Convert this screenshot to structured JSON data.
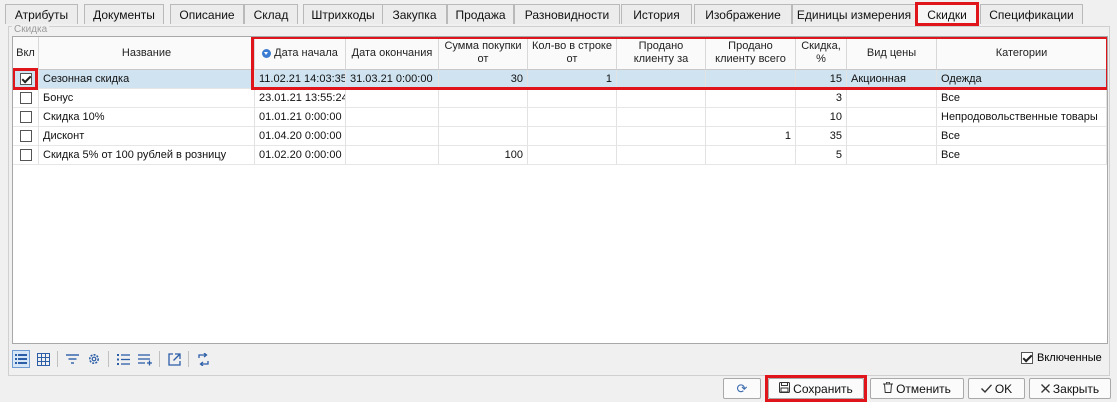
{
  "tabs": [
    {
      "label": "Атрибуты"
    },
    {
      "label": "Документы"
    },
    {
      "label": "Описание"
    },
    {
      "label": "Склад"
    },
    {
      "label": "Штрихкоды"
    },
    {
      "label": "Закупка"
    },
    {
      "label": "Продажа"
    },
    {
      "label": "Разновидности"
    },
    {
      "label": "История"
    },
    {
      "label": "Изображение"
    },
    {
      "label": "Единицы измерения"
    },
    {
      "label": "Скидки"
    },
    {
      "label": "Спецификации"
    }
  ],
  "group_title": "Скидка",
  "grid": {
    "columns": [
      {
        "label": "Вкл"
      },
      {
        "label": "Название"
      },
      {
        "label": "Дата начала"
      },
      {
        "label": "Дата окончания"
      },
      {
        "label": "Сумма покупки от"
      },
      {
        "label": "Кол-во в строке от"
      },
      {
        "label": "Продано клиенту за"
      },
      {
        "label": "Продано клиенту всего"
      },
      {
        "label": "Скидка, %"
      },
      {
        "label": "Вид цены"
      },
      {
        "label": "Категории"
      }
    ],
    "rows": [
      {
        "enabled": true,
        "name": "Сезонная скидка",
        "start": "11.02.21 14:03:35",
        "end": "31.03.21 0:00:00",
        "sum_from": "30",
        "qty_from": "1",
        "sold_for": "",
        "sold_total": "",
        "discount": "15",
        "price_type": "Акционная",
        "category": "Одежда"
      },
      {
        "enabled": false,
        "name": "Бонус",
        "start": "23.01.21 13:55:24",
        "end": "",
        "sum_from": "",
        "qty_from": "",
        "sold_for": "",
        "sold_total": "",
        "discount": "3",
        "price_type": "",
        "category": "Все"
      },
      {
        "enabled": false,
        "name": "Скидка 10%",
        "start": "01.01.21 0:00:00",
        "end": "",
        "sum_from": "",
        "qty_from": "",
        "sold_for": "",
        "sold_total": "",
        "discount": "10",
        "price_type": "",
        "category": "Непродовольственные товары"
      },
      {
        "enabled": false,
        "name": "Дисконт",
        "start": "01.04.20 0:00:00",
        "end": "",
        "sum_from": "",
        "qty_from": "",
        "sold_for": "",
        "sold_total": "1",
        "discount": "35",
        "price_type": "",
        "category": "Все"
      },
      {
        "enabled": false,
        "name": "Скидка 5% от 100 рублей в розницу",
        "start": "01.02.20 0:00:00",
        "end": "",
        "sum_from": "100",
        "qty_from": "",
        "sold_for": "",
        "sold_total": "",
        "discount": "5",
        "price_type": "",
        "category": "Все"
      }
    ]
  },
  "toolbar": {
    "icons": [
      "list-view-icon",
      "table-view-icon",
      "filter-icon",
      "settings-gear-icon",
      "numbered-list-icon",
      "add-rows-icon",
      "export-icon",
      "refresh-link-icon"
    ]
  },
  "only_enabled": {
    "label": "Включенные",
    "checked": true
  },
  "buttons": {
    "refresh": "",
    "save": "Сохранить",
    "cancel": "Отменить",
    "ok": "OK",
    "close": "Закрыть"
  },
  "accent_color": "#e0141b",
  "selection_color": "#cfe3f0"
}
